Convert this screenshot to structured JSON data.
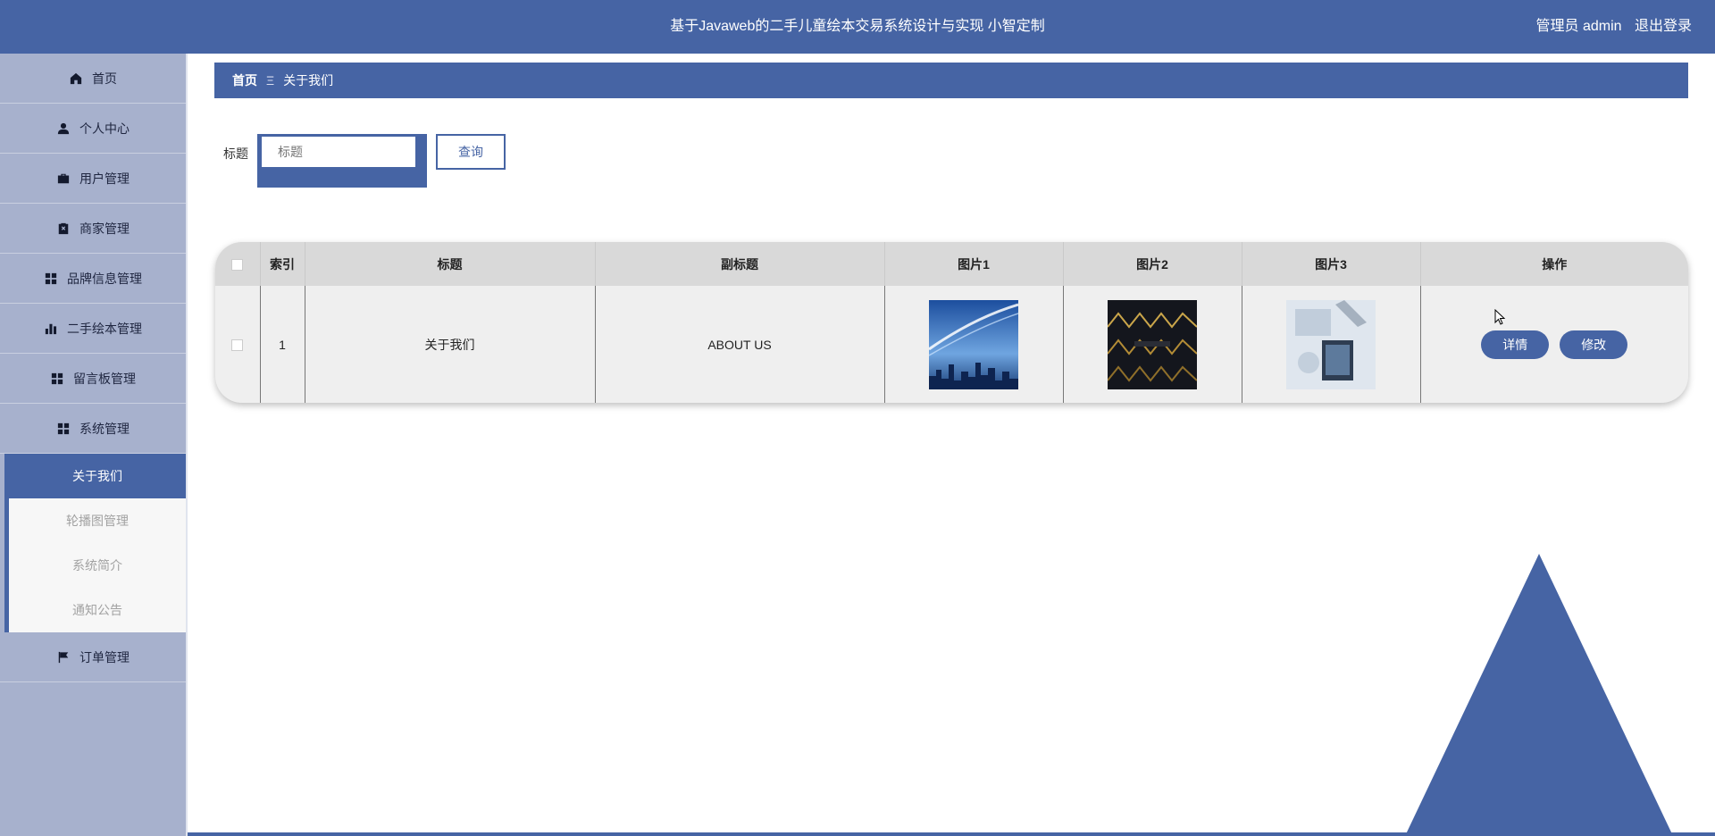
{
  "header": {
    "title": "基于Javaweb的二手儿童绘本交易系统设计与实现 小智定制",
    "user_label": "管理员 admin",
    "logout_label": "退出登录"
  },
  "sidebar": {
    "items": [
      {
        "label": "首页",
        "icon": "home-icon"
      },
      {
        "label": "个人中心",
        "icon": "person-icon"
      },
      {
        "label": "用户管理",
        "icon": "briefcase-icon"
      },
      {
        "label": "商家管理",
        "icon": "clipboard-icon"
      },
      {
        "label": "品牌信息管理",
        "icon": "grid-icon"
      },
      {
        "label": "二手绘本管理",
        "icon": "bar-chart-icon"
      },
      {
        "label": "留言板管理",
        "icon": "grid-icon"
      },
      {
        "label": "系统管理",
        "icon": "grid-icon"
      }
    ],
    "sub_items": [
      {
        "label": "关于我们",
        "active": true
      },
      {
        "label": "轮播图管理",
        "active": false
      },
      {
        "label": "系统简介",
        "active": false
      },
      {
        "label": "通知公告",
        "active": false
      }
    ],
    "last_item": {
      "label": "订单管理",
      "icon": "flag-icon"
    }
  },
  "breadcrumb": {
    "home": "首页",
    "separator": "Ξ",
    "current": "关于我们"
  },
  "search": {
    "label": "标题",
    "placeholder": "标题",
    "value": "",
    "button_label": "查询"
  },
  "table": {
    "columns": [
      "索引",
      "标题",
      "副标题",
      "图片1",
      "图片2",
      "图片3",
      "操作"
    ],
    "rows": [
      {
        "index": "1",
        "title": "关于我们",
        "subtitle": "ABOUT US",
        "image1": "city-skyline-image",
        "image2": "gold-pattern-image",
        "image3": "business-image",
        "detail_label": "详情",
        "edit_label": "修改"
      }
    ]
  },
  "colors": {
    "primary": "#4664a4",
    "sidebar_bg": "#a7b1cd",
    "table_header": "#d9d9d9",
    "table_body": "#efefef"
  }
}
